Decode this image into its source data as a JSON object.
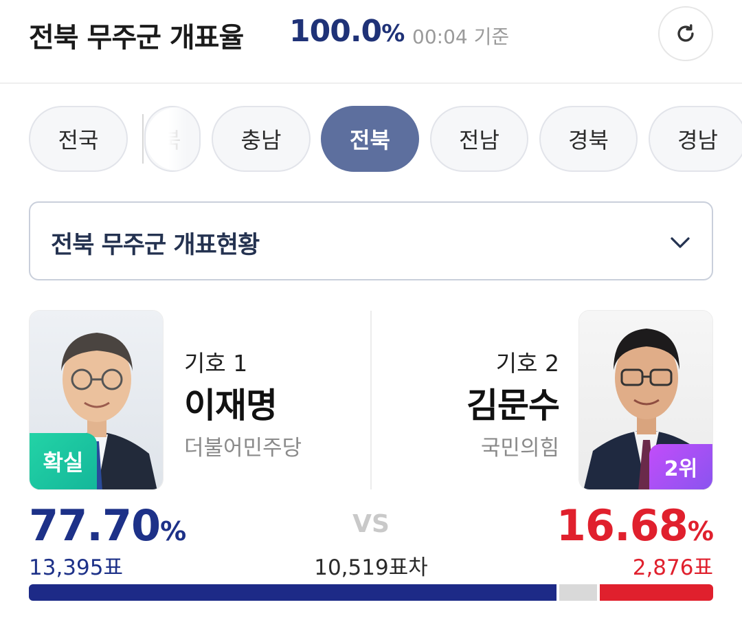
{
  "header": {
    "title": "전북 무주군 개표율",
    "count_rate": "100.0",
    "count_rate_unit": "%",
    "timestamp": "00:04 기준",
    "refresh_icon": "refresh-icon"
  },
  "regions": {
    "items": [
      {
        "label": "전국",
        "active": false
      },
      {
        "label": "북",
        "active": false,
        "partial": true
      },
      {
        "label": "충남",
        "active": false
      },
      {
        "label": "전북",
        "active": true
      },
      {
        "label": "전남",
        "active": false
      },
      {
        "label": "경북",
        "active": false
      },
      {
        "label": "경남",
        "active": false
      }
    ]
  },
  "district": {
    "selected": "전북 무주군 개표현황",
    "icon": "chevron-down-icon"
  },
  "candidates": [
    {
      "number_label": "기호 1",
      "name": "이재명",
      "party": "더불어민주당",
      "badge": "확실",
      "percent": "77.70",
      "percent_unit": "%",
      "votes": "13,395표",
      "vote_share": 0.777,
      "color": "#1d2a87"
    },
    {
      "number_label": "기호 2",
      "name": "김문수",
      "party": "국민의힘",
      "badge": "2위",
      "percent": "16.68",
      "percent_unit": "%",
      "votes": "2,876표",
      "vote_share": 0.1668,
      "color": "#e0202d"
    }
  ],
  "comparison": {
    "vs_label": "VS",
    "margin": "10,519표차",
    "other_share": 0.0562
  }
}
